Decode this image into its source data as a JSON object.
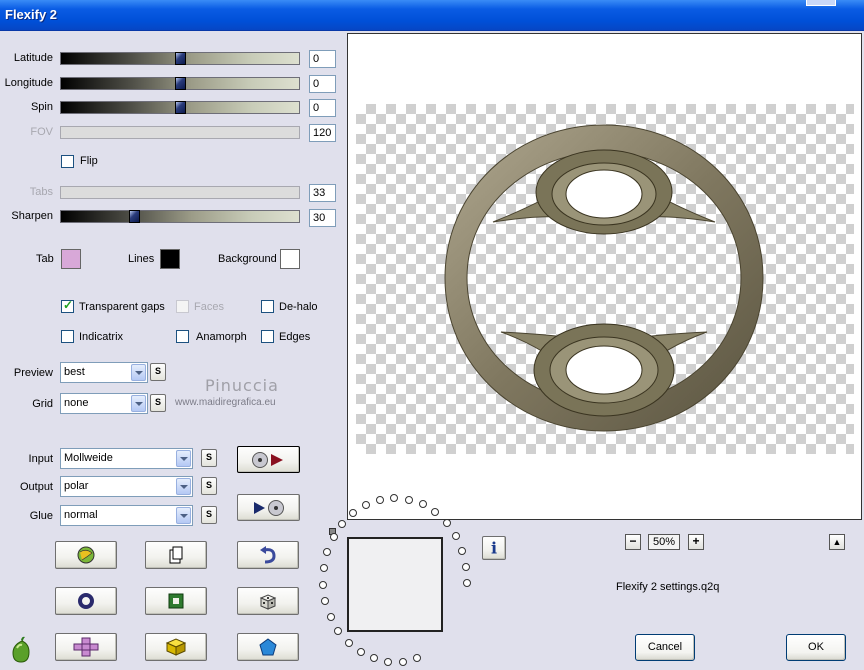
{
  "window": {
    "title": "Flexify 2"
  },
  "sliders": [
    {
      "label": "Latitude",
      "value": "0",
      "enabled": true,
      "level": 0.5
    },
    {
      "label": "Longitude",
      "value": "0",
      "enabled": true,
      "level": 0.5
    },
    {
      "label": "Spin",
      "value": "0",
      "enabled": true,
      "level": 0.5
    },
    {
      "label": "FOV",
      "value": "120",
      "enabled": false
    },
    {
      "label": "Tabs",
      "value": "33",
      "enabled": false
    },
    {
      "label": "Sharpen",
      "value": "30",
      "enabled": true,
      "level": 0.3
    }
  ],
  "flip": {
    "label": "Flip",
    "checked": false
  },
  "colors": {
    "tab": {
      "label": "Tab",
      "color": "#d8a8d8"
    },
    "lines": {
      "label": "Lines",
      "color": "#000000"
    },
    "background": {
      "label": "Background",
      "color": "#ffffff"
    }
  },
  "options": {
    "transparent_gaps": {
      "label": "Transparent gaps",
      "checked": true
    },
    "faces": {
      "label": "Faces",
      "checked": false,
      "enabled": false
    },
    "de_halo": {
      "label": "De-halo",
      "checked": false
    },
    "indicatrix": {
      "label": "Indicatrix",
      "checked": false
    },
    "anamorph": {
      "label": "Anamorph",
      "checked": false
    },
    "edges": {
      "label": "Edges",
      "checked": false
    }
  },
  "preview": {
    "label": "Preview",
    "value": "best"
  },
  "grid": {
    "label": "Grid",
    "value": "none"
  },
  "input": {
    "label": "Input",
    "value": "Mollweide"
  },
  "output": {
    "label": "Output",
    "value": "polar"
  },
  "glue": {
    "label": "Glue",
    "value": "normal"
  },
  "s_label": "S",
  "watermark": {
    "name": "Pinuccia",
    "url": "www.maidiregrafica.eu"
  },
  "zoom": {
    "value": "50%",
    "minus": "−",
    "plus": "+"
  },
  "info_label": "i",
  "settings_file": "Flexify 2 settings.q2q",
  "buttons": {
    "cancel": "Cancel",
    "ok": "OK"
  }
}
